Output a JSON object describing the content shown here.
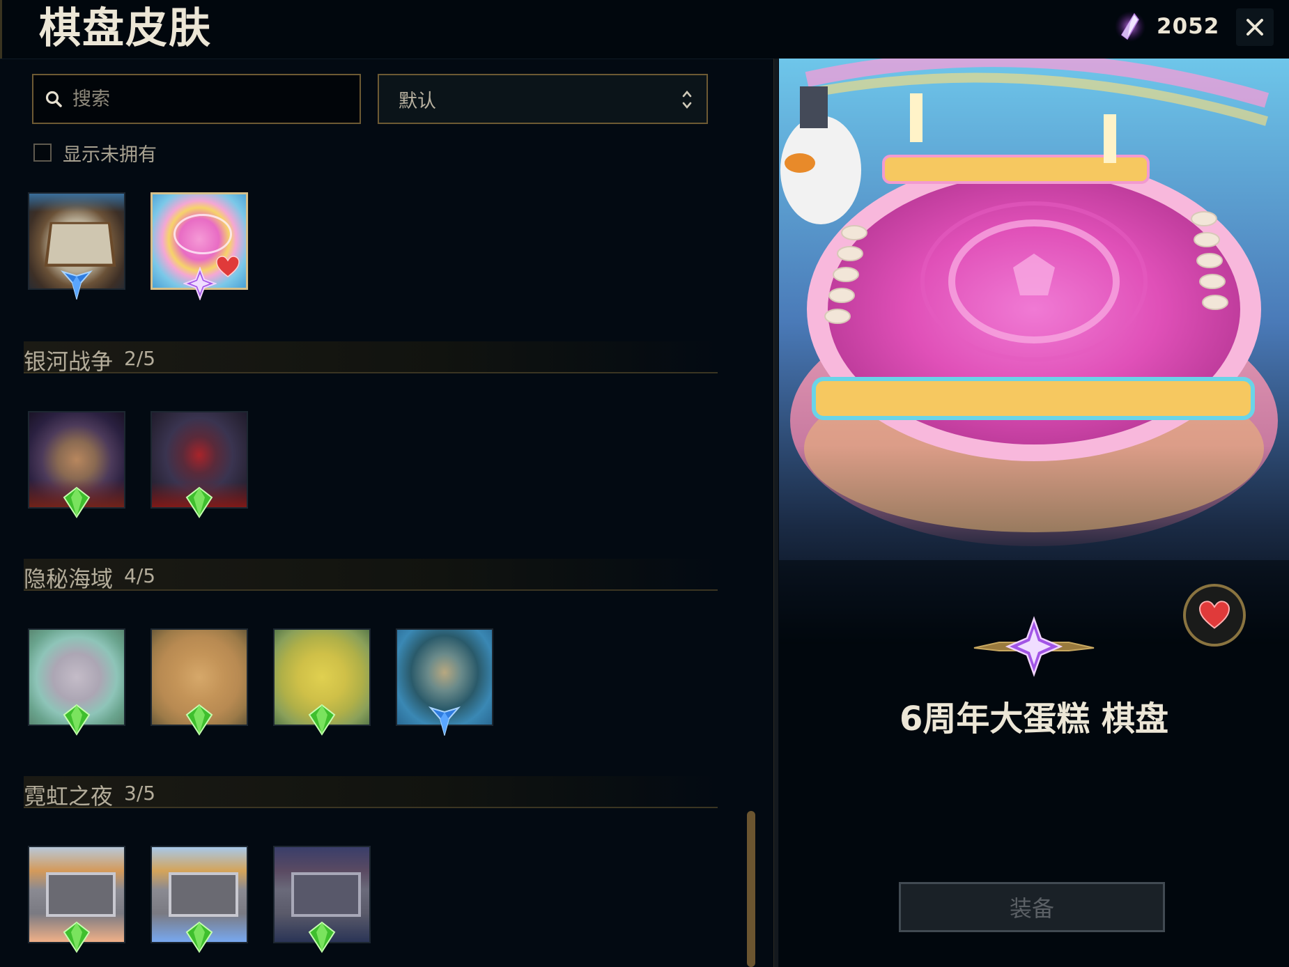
{
  "header": {
    "title": "棋盘皮肤",
    "currency_amount": "2052",
    "currency_icon": "rare-shard-icon",
    "close_icon": "close-icon"
  },
  "filters": {
    "search_placeholder": "搜索",
    "sort_value": "默认",
    "show_unowned_label": "显示未拥有",
    "show_unowned_checked": false
  },
  "top_items": [
    {
      "theme": "stone-arena",
      "rarity": "blue",
      "selected": false,
      "favorite": false
    },
    {
      "theme": "birthday-cake",
      "rarity": "purple",
      "selected": true,
      "favorite": true
    }
  ],
  "sections": [
    {
      "name": "银河战争",
      "count": "2/5",
      "items": [
        {
          "theme": "galaxy-dark",
          "rarity": "green"
        },
        {
          "theme": "galaxy-red",
          "rarity": "green"
        }
      ]
    },
    {
      "name": "隐秘海域",
      "count": "4/5",
      "items": [
        {
          "theme": "sea-light",
          "rarity": "green"
        },
        {
          "theme": "sea-gold",
          "rarity": "green"
        },
        {
          "theme": "sea-yellow",
          "rarity": "green"
        },
        {
          "theme": "sea-blue",
          "rarity": "blue"
        }
      ]
    },
    {
      "name": "霓虹之夜",
      "count": "3/5",
      "items": [
        {
          "theme": "neon-orange",
          "rarity": "green"
        },
        {
          "theme": "neon-blue",
          "rarity": "green"
        },
        {
          "theme": "neon-night",
          "rarity": "green"
        }
      ]
    }
  ],
  "colors": {
    "accent_gold": "#6d5a33",
    "rarity_green": "#3fbf2e",
    "rarity_blue": "#3a8be8",
    "rarity_purple": "#a860e8",
    "favorite_red": "#d92b2b"
  },
  "detail": {
    "name": "6周年大蛋糕 棋盘",
    "rarity": "purple",
    "favorite": true,
    "equip_label": "装备",
    "equip_enabled": false
  }
}
